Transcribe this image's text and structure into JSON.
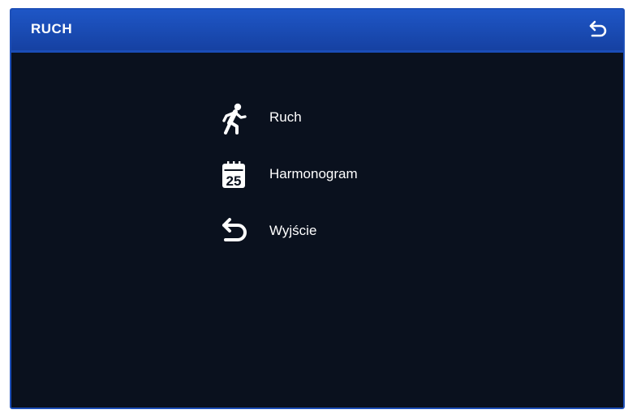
{
  "window": {
    "title": "RUCH",
    "back_icon": "return-arrow-icon"
  },
  "menu": {
    "items": [
      {
        "label": "Ruch",
        "icon": "walking-person-icon"
      },
      {
        "label": "Harmonogram",
        "icon": "calendar-icon",
        "calendar_day": "25"
      },
      {
        "label": "Wyjście",
        "icon": "return-arrow-icon"
      }
    ]
  },
  "colors": {
    "title_bar": "#1e56c6",
    "background": "#0a111e",
    "text": "#ffffff"
  }
}
